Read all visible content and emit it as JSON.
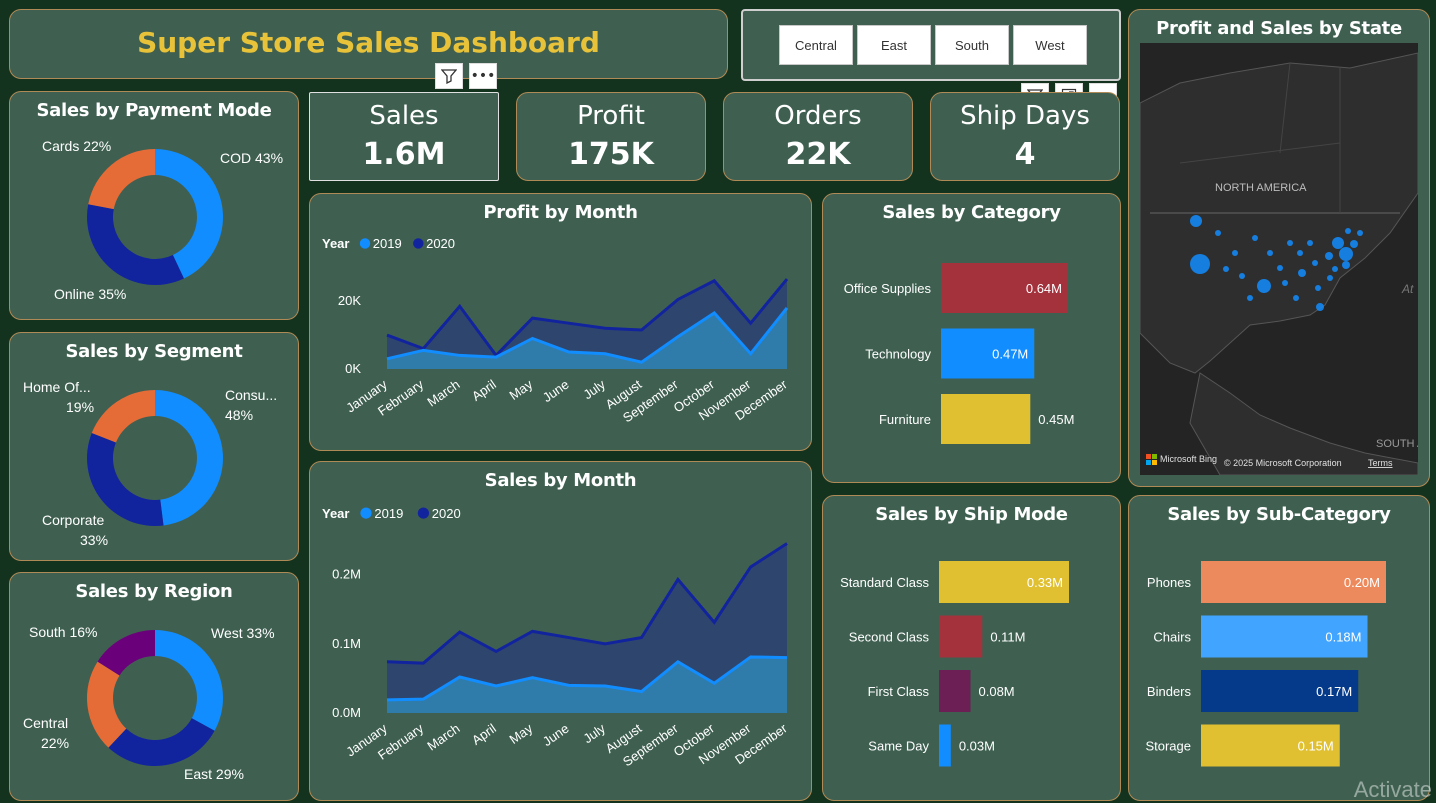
{
  "header": {
    "title": "Super Store Sales Dashboard"
  },
  "slicer": {
    "regions": [
      "Central",
      "East",
      "South",
      "West"
    ]
  },
  "kpis": [
    {
      "label": "Sales",
      "value": "1.6M"
    },
    {
      "label": "Profit",
      "value": "175K"
    },
    {
      "label": "Orders",
      "value": "22K"
    },
    {
      "label": "Ship Days",
      "value": "4"
    }
  ],
  "colors": {
    "accent_title": "#e8c33a",
    "light_blue": "#118dff",
    "dark_blue": "#12239e",
    "orange": "#e66c37",
    "purple": "#6b007b",
    "card_bg": "#3f6051"
  },
  "map": {
    "title": "Profit and Sales by State",
    "region_label": "NORTH AMERICA",
    "region_label_2": "SOUTH A",
    "ocean_label": "At",
    "credit": "Microsoft Bing",
    "copyright": "© 2025 Microsoft Corporation",
    "terms": "Terms"
  },
  "watermark": "Activate",
  "chart_data": [
    {
      "type": "pie",
      "title": "Sales by Payment Mode",
      "slices": [
        {
          "name": "COD",
          "value": 43,
          "label": "COD 43%",
          "color": "#118dff"
        },
        {
          "name": "Online",
          "value": 35,
          "label": "Online 35%",
          "color": "#12239e"
        },
        {
          "name": "Cards",
          "value": 22,
          "label": "Cards 22%",
          "color": "#e66c37"
        }
      ]
    },
    {
      "type": "pie",
      "title": "Sales by Segment",
      "slices": [
        {
          "name": "Consu...",
          "value": 48,
          "label": "Consu...",
          "pct": "48%",
          "color": "#118dff"
        },
        {
          "name": "Corporate",
          "value": 33,
          "label": "Corporate",
          "pct": "33%",
          "color": "#12239e"
        },
        {
          "name": "Home Of...",
          "value": 19,
          "label": "Home Of...",
          "pct": "19%",
          "color": "#e66c37"
        }
      ]
    },
    {
      "type": "pie",
      "title": "Sales by Region",
      "slices": [
        {
          "name": "West",
          "value": 33,
          "label": "West 33%",
          "color": "#118dff"
        },
        {
          "name": "East",
          "value": 29,
          "label": "East 29%",
          "color": "#12239e"
        },
        {
          "name": "Central",
          "value": 22,
          "label": "Central",
          "pct": "22%",
          "color": "#e66c37"
        },
        {
          "name": "South",
          "value": 16,
          "label": "South 16%",
          "color": "#6b007b"
        }
      ]
    },
    {
      "type": "area",
      "title": "Profit by Month",
      "legend_title": "Year",
      "categories": [
        "January",
        "February",
        "March",
        "April",
        "May",
        "June",
        "July",
        "August",
        "September",
        "October",
        "November",
        "December"
      ],
      "series": [
        {
          "name": "2019",
          "color": "#118dff",
          "values": [
            3000,
            5500,
            4000,
            3500,
            9000,
            5000,
            4500,
            2000,
            9500,
            16500,
            4500,
            18000
          ]
        },
        {
          "name": "2020",
          "color": "#12239e",
          "values": [
            10000,
            6000,
            18500,
            4000,
            15000,
            13500,
            12000,
            11500,
            20500,
            26000,
            13500,
            26500
          ]
        }
      ],
      "yticks": [
        {
          "v": 0,
          "t": "0K"
        },
        {
          "v": 20000,
          "t": "20K"
        }
      ],
      "ylim": [
        0,
        28000
      ]
    },
    {
      "type": "area",
      "title": "Sales by Month",
      "legend_title": "Year",
      "categories": [
        "January",
        "February",
        "March",
        "April",
        "May",
        "June",
        "July",
        "August",
        "September",
        "October",
        "November",
        "December"
      ],
      "series": [
        {
          "name": "2019",
          "color": "#118dff",
          "values": [
            0.019,
            0.02,
            0.052,
            0.039,
            0.051,
            0.04,
            0.039,
            0.031,
            0.074,
            0.043,
            0.081,
            0.08
          ]
        },
        {
          "name": "2020",
          "color": "#12239e",
          "values": [
            0.074,
            0.072,
            0.117,
            0.089,
            0.118,
            0.109,
            0.1,
            0.109,
            0.193,
            0.131,
            0.211,
            0.245
          ]
        }
      ],
      "yticks": [
        {
          "v": 0,
          "t": "0.0M"
        },
        {
          "v": 0.1,
          "t": "0.1M"
        },
        {
          "v": 0.2,
          "t": "0.2M"
        }
      ],
      "ylim": [
        0,
        0.25
      ]
    },
    {
      "type": "bar",
      "title": "Sales by Category",
      "categories": [
        "Office Supplies",
        "Technology",
        "Furniture"
      ],
      "values": [
        0.64,
        0.47,
        0.45
      ],
      "labels": [
        "0.64M",
        "0.47M",
        "0.45M"
      ],
      "colors": [
        "#a3323c",
        "#118dff",
        "#e0c030"
      ]
    },
    {
      "type": "bar",
      "title": "Sales by Ship Mode",
      "categories": [
        "Standard Class",
        "Second Class",
        "First Class",
        "Same Day"
      ],
      "values": [
        0.33,
        0.11,
        0.08,
        0.03
      ],
      "labels": [
        "0.33M",
        "0.11M",
        "0.08M",
        "0.03M"
      ],
      "colors": [
        "#e0c030",
        "#a3323c",
        "#6b1f55",
        "#118dff"
      ]
    },
    {
      "type": "bar",
      "title": "Sales by Sub-Category",
      "categories": [
        "Phones",
        "Chairs",
        "Binders",
        "Storage"
      ],
      "values": [
        0.2,
        0.18,
        0.17,
        0.15
      ],
      "labels": [
        "0.20M",
        "0.18M",
        "0.17M",
        "0.15M"
      ],
      "colors": [
        "#ec8a5e",
        "#41a4ff",
        "#053a8a",
        "#e0c030"
      ]
    }
  ]
}
